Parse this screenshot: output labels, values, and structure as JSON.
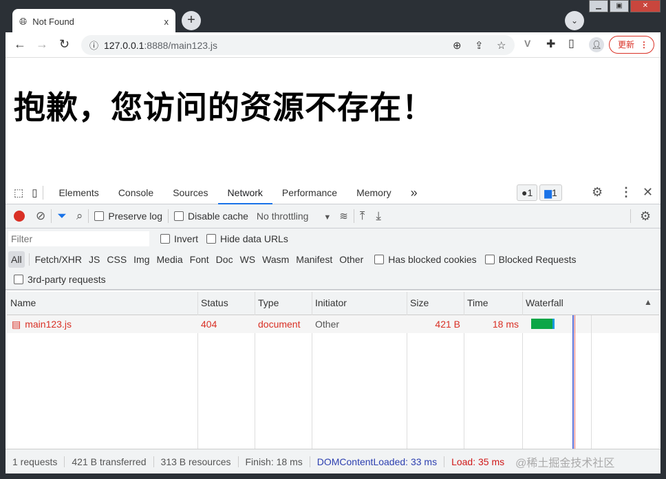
{
  "browser": {
    "tab_title": "Not Found",
    "tab_close": "x",
    "new_tab": "+",
    "url_host": "127.0.0.1",
    "url_rest": ":8888/main123.js",
    "update_label": "更新"
  },
  "page": {
    "heading": "抱歉，您访问的资源不存在！"
  },
  "devtools": {
    "tabs": [
      "Elements",
      "Console",
      "Sources",
      "Network",
      "Performance",
      "Memory"
    ],
    "more_tabs": "»",
    "error_count": "1",
    "message_count": "1",
    "toolbar": {
      "preserve_log": "Preserve log",
      "disable_cache": "Disable cache",
      "throttling": "No throttling"
    },
    "filter": {
      "placeholder": "Filter",
      "invert": "Invert",
      "hide_data_urls": "Hide data URLs"
    },
    "types": [
      "All",
      "Fetch/XHR",
      "JS",
      "CSS",
      "Img",
      "Media",
      "Font",
      "Doc",
      "WS",
      "Wasm",
      "Manifest",
      "Other"
    ],
    "has_blocked_cookies": "Has blocked cookies",
    "blocked_requests": "Blocked Requests",
    "third_party": "3rd-party requests",
    "columns": [
      "Name",
      "Status",
      "Type",
      "Initiator",
      "Size",
      "Time",
      "Waterfall"
    ],
    "rows": [
      {
        "name": "main123.js",
        "status": "404",
        "type": "document",
        "initiator": "Other",
        "size": "421 B",
        "time": "18 ms"
      }
    ],
    "summary": {
      "requests": "1 requests",
      "transferred": "421 B transferred",
      "resources": "313 B resources",
      "finish": "Finish: 18 ms",
      "dcl": "DOMContentLoaded: 33 ms",
      "load": "Load: 35 ms"
    }
  },
  "watermark": "@稀土掘金技术社区"
}
